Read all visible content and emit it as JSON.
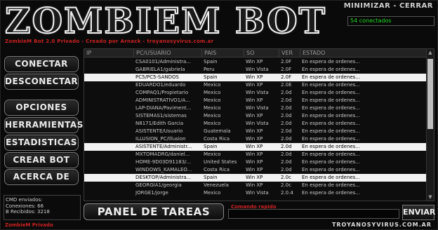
{
  "app": {
    "title": "ZOMBIEM BOT",
    "subtitle": "ZombieM Bot 2.0 Privado - Creado por Arnack - troyanosyvirus.com.ar",
    "minimize_label": "MINIMIZAR",
    "separator": "-",
    "close_label": "CERRAR",
    "connected_text": "54 conectados"
  },
  "sidebar": {
    "buttons": [
      {
        "label": "CONECTAR"
      },
      {
        "label": "DESCONECTAR"
      },
      {
        "label": "OPCIONES"
      },
      {
        "label": "HERRAMIENTAS"
      },
      {
        "label": "ESTADISTICAS"
      },
      {
        "label": "CREAR BOT"
      },
      {
        "label": "ACERCA DE"
      }
    ],
    "cmd_info": {
      "line1": "CMD enviados:",
      "line2": "Conexiones: 66",
      "line3": "B Recibidos: 3218"
    }
  },
  "table": {
    "headers": [
      "IP",
      "PC/USUARIO",
      "PAIS",
      "SO",
      "VER",
      "ESTADO"
    ],
    "rows": [
      {
        "ip": "",
        "pc": "CSA0101/Administra...",
        "pais": "Spain",
        "so": "Win XP",
        "ver": "2.0F",
        "estado": "En espera de ordenes...",
        "selected": false
      },
      {
        "ip": "",
        "pc": "GABRIELA1/gabriela",
        "pais": "Peru",
        "so": "Win Vista",
        "ver": "2.0F",
        "estado": "En espera de ordenes...",
        "selected": false
      },
      {
        "ip": "",
        "pc": "PC5/PC5-SANDOS",
        "pais": "Spain",
        "so": "Win XP",
        "ver": "2.0F",
        "estado": "En espera de ordenes...",
        "selected": true
      },
      {
        "ip": "",
        "pc": "EDUARDO1/eduardo",
        "pais": "Mexico",
        "so": "Win XP",
        "ver": "2.0E",
        "estado": "En espera de ordenes...",
        "selected": false
      },
      {
        "ip": "",
        "pc": "COMPAQ1/Propietario",
        "pais": "Mexico",
        "so": "Win Vista",
        "ver": "2.0d",
        "estado": "En espera de ordenes...",
        "selected": false
      },
      {
        "ip": "",
        "pc": "ADMINISTRATIVO1/A...",
        "pais": "Mexico",
        "so": "Win XP",
        "ver": "2.0d",
        "estado": "En espera de ordenes...",
        "selected": false
      },
      {
        "ip": "",
        "pc": "LAP-DIANA/Paviment...",
        "pais": "Mexico",
        "so": "Win Vista",
        "ver": "2.0d",
        "estado": "En espera de ordenes...",
        "selected": false
      },
      {
        "ip": "",
        "pc": "SISTEMAS1/sistemas",
        "pais": "Mexico",
        "so": "Win XP",
        "ver": "2.0d",
        "estado": "En espera de ordenes...",
        "selected": false
      },
      {
        "ip": "",
        "pc": "N8171/Edith Garcia",
        "pais": "Mexico",
        "so": "Win Vista",
        "ver": "2.0d",
        "estado": "En espera de ordenes...",
        "selected": false
      },
      {
        "ip": "",
        "pc": "ASISTENTE/Usuario",
        "pais": "Guatemala",
        "so": "Win XP",
        "ver": "2.0d",
        "estado": "En espera de ordenes...",
        "selected": false
      },
      {
        "ip": "",
        "pc": "ILLUSION_PC/Illusion",
        "pais": "Costa Rica",
        "so": "Win XP",
        "ver": "2.0d",
        "estado": "En espera de ordenes...",
        "selected": false
      },
      {
        "ip": "",
        "pc": "ASISTENTE/Administr...",
        "pais": "Spain",
        "so": "Win XP",
        "ver": "2.0d",
        "estado": "En espera de ordenes...",
        "selected": true
      },
      {
        "ip": "",
        "pc": "MXTOMADRG/daniel...",
        "pais": "Mexico",
        "so": "Win XP",
        "ver": "2.0d",
        "estado": "En espera de ordenes...",
        "selected": false
      },
      {
        "ip": "",
        "pc": "HOME-9D03D91183/...",
        "pais": "United States",
        "so": "Win XP",
        "ver": "2.0d",
        "estado": "En espera de ordenes...",
        "selected": false
      },
      {
        "ip": "",
        "pc": "WINDOWS_KAMALEO...",
        "pais": "Costa Rica",
        "so": "Win XP",
        "ver": "2.0d",
        "estado": "En espera de ordenes...",
        "selected": false
      },
      {
        "ip": "",
        "pc": "DESKTOP/Administra...",
        "pais": "Spain",
        "so": "Win XP",
        "ver": "2.0c",
        "estado": "En espera de ordenes...",
        "selected": true
      },
      {
        "ip": "",
        "pc": "GEORGIA1/georgia",
        "pais": "Venezuela",
        "so": "Win XP",
        "ver": "2.0c",
        "estado": "En espera de ordenes...",
        "selected": false
      },
      {
        "ip": "",
        "pc": "JORGE1/jorge",
        "pais": "Mexico",
        "so": "Win Vista",
        "ver": "2.0.4",
        "estado": "En espera de ordenes...",
        "selected": false
      }
    ]
  },
  "bottom": {
    "panel_label": "PANEL DE TAREAS",
    "command_label": "Comando rapido",
    "command_value": "",
    "send_label": "ENVIAR",
    "footer_left": "ZombieM Privado",
    "footer_right": "TROYANOSYVIRUS.COM.AR"
  }
}
